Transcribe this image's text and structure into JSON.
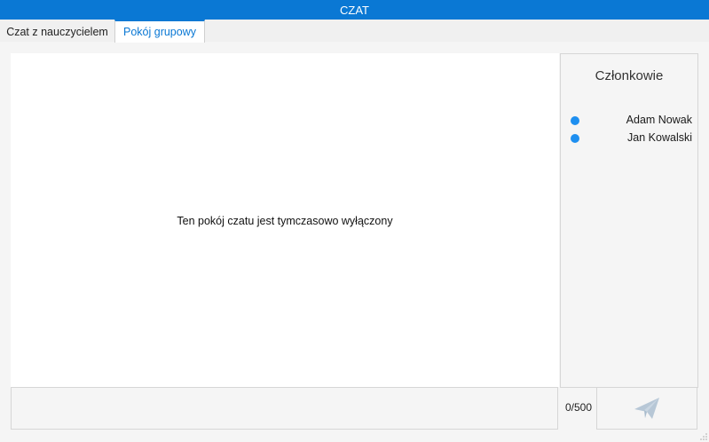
{
  "window": {
    "title": "CZAT"
  },
  "tabs": [
    {
      "label": "Czat z nauczycielem",
      "active": false
    },
    {
      "label": "Pokój grupowy",
      "active": true
    }
  ],
  "chat": {
    "message": "Ten pokój czatu jest tymczasowo wyłączony"
  },
  "members": {
    "title": "Członkowie",
    "list": [
      {
        "name": "Adam Nowak",
        "status_color": "#1e8ff0"
      },
      {
        "name": "Jan Kowalski",
        "status_color": "#1e8ff0"
      }
    ]
  },
  "input": {
    "value": "",
    "counter": "0/500"
  },
  "send_button": {
    "icon": "paper-plane-icon",
    "enabled": false
  },
  "colors": {
    "accent": "#0a78d4",
    "status_online": "#1e8ff0",
    "send_icon_disabled": "#b7c7d6"
  }
}
